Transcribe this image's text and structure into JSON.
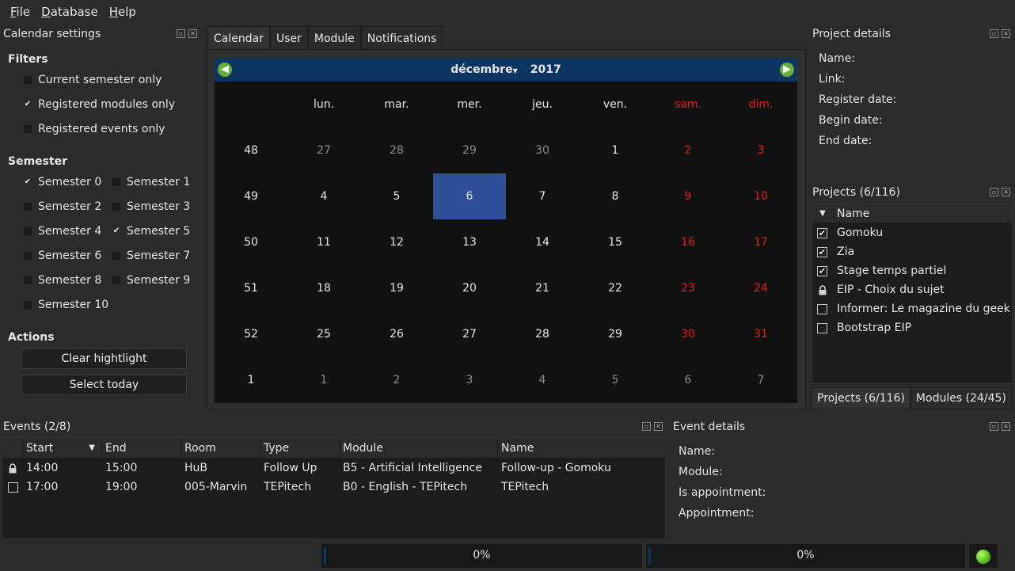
{
  "menu": [
    "File",
    "Database",
    "Help"
  ],
  "calendar_settings": {
    "title": "Calendar settings",
    "filters_title": "Filters",
    "filters": [
      {
        "label": "Current semester only",
        "checked": false
      },
      {
        "label": "Registered modules only",
        "checked": true
      },
      {
        "label": "Registered events only",
        "checked": false
      }
    ],
    "semester_title": "Semester",
    "semesters": [
      {
        "label": "Semester 0",
        "checked": true
      },
      {
        "label": "Semester 1",
        "checked": false
      },
      {
        "label": "Semester 2",
        "checked": false
      },
      {
        "label": "Semester 3",
        "checked": false
      },
      {
        "label": "Semester 4",
        "checked": false
      },
      {
        "label": "Semester 5",
        "checked": true
      },
      {
        "label": "Semester 6",
        "checked": false
      },
      {
        "label": "Semester 7",
        "checked": false
      },
      {
        "label": "Semester 8",
        "checked": false
      },
      {
        "label": "Semester 9",
        "checked": false
      },
      {
        "label": "Semester 10",
        "checked": false
      }
    ],
    "actions_title": "Actions",
    "clear_label": "Clear hightlight",
    "today_label": "Select today"
  },
  "tabs": [
    "Calendar",
    "User",
    "Module",
    "Notifications"
  ],
  "calendar": {
    "month": "décembre",
    "year": "2017",
    "headers": [
      "",
      "lun.",
      "mar.",
      "mer.",
      "jeu.",
      "ven.",
      "sam.",
      "dim."
    ],
    "weeks": [
      {
        "week": "48",
        "days": [
          "27",
          "28",
          "29",
          "30",
          "1",
          "2",
          "3"
        ]
      },
      {
        "week": "49",
        "days": [
          "4",
          "5",
          "6",
          "7",
          "8",
          "9",
          "10"
        ]
      },
      {
        "week": "50",
        "days": [
          "11",
          "12",
          "13",
          "14",
          "15",
          "16",
          "17"
        ]
      },
      {
        "week": "51",
        "days": [
          "18",
          "19",
          "20",
          "21",
          "22",
          "23",
          "24"
        ]
      },
      {
        "week": "52",
        "days": [
          "25",
          "26",
          "27",
          "28",
          "29",
          "30",
          "31"
        ]
      },
      {
        "week": "1",
        "days": [
          "1",
          "2",
          "3",
          "4",
          "5",
          "6",
          "7"
        ]
      }
    ],
    "selected_day": "6"
  },
  "project_details": {
    "title": "Project details",
    "labels": [
      "Name:",
      "Link:",
      "Register date:",
      "Begin date:",
      "End date:"
    ]
  },
  "projects": {
    "title": "Projects (6/116)",
    "column": "Name",
    "items": [
      {
        "name": "Gomoku",
        "state": "checked"
      },
      {
        "name": "Zia",
        "state": "checked"
      },
      {
        "name": "Stage temps partiel",
        "state": "checked"
      },
      {
        "name": "EIP - Choix du sujet",
        "state": "locked"
      },
      {
        "name": "Informer: Le magazine du geek",
        "state": "unchecked"
      },
      {
        "name": "Bootstrap EIP",
        "state": "unchecked"
      }
    ],
    "bottom_tabs": [
      "Projects (6/116)",
      "Modules (24/45)"
    ]
  },
  "events": {
    "title": "Events (2/8)",
    "columns": [
      "Start",
      "End",
      "Room",
      "Type",
      "Module",
      "Name"
    ],
    "rows": [
      {
        "state": "locked",
        "cells": [
          "14:00",
          "15:00",
          "HuB",
          "Follow Up",
          "B5 - Artificial Intelligence",
          "Follow-up - Gomoku"
        ]
      },
      {
        "state": "unchecked",
        "cells": [
          "17:00",
          "19:00",
          "005-Marvin",
          "TEPitech",
          "B0 - English - TEPitech",
          "TEPitech"
        ]
      }
    ]
  },
  "event_details": {
    "title": "Event details",
    "labels": [
      "Name:",
      "Module:",
      "Is appointment:",
      "Appointment:"
    ]
  },
  "status": {
    "progress1": "0%",
    "progress2": "0%",
    "progress1_value": 0,
    "progress2_value": 0,
    "indicator_color": "#5fc21b"
  }
}
